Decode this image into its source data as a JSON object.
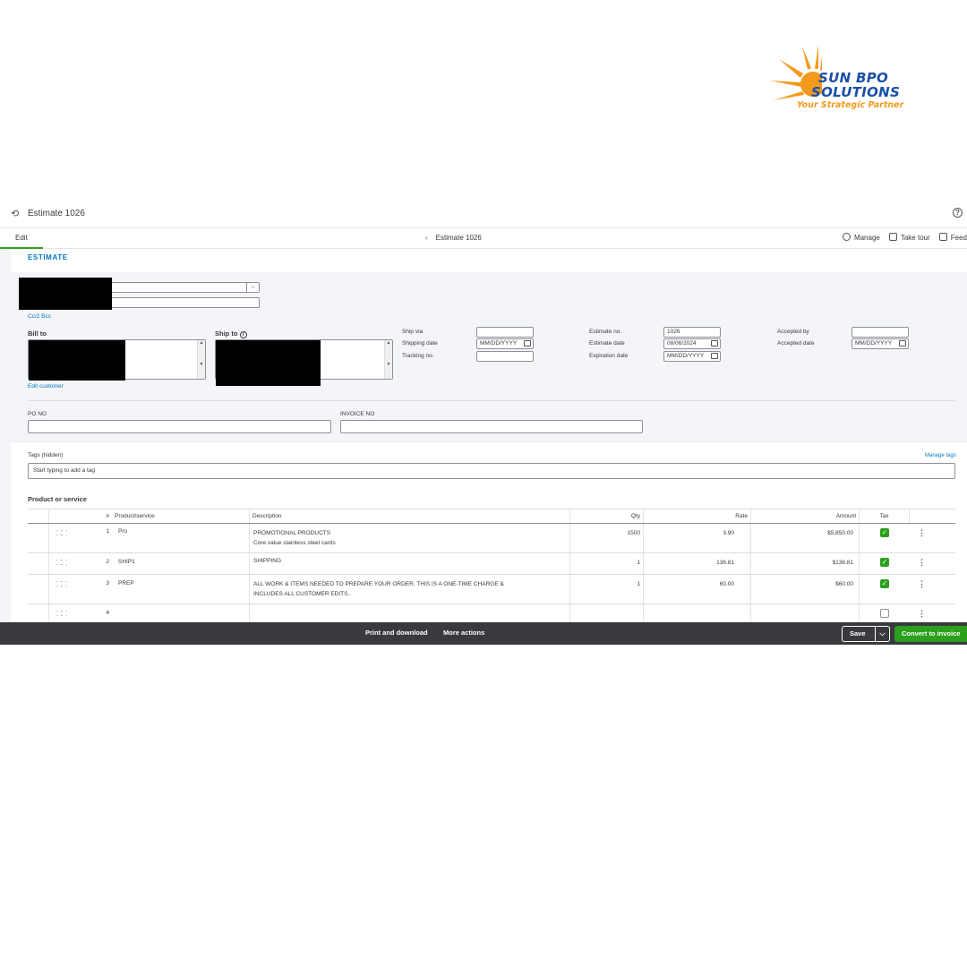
{
  "logo": {
    "line1": "SUN BPO",
    "line2": "SOLUTIONS",
    "tagline": "Your Strategic Partner",
    "colors": {
      "sun": "#f39a1e",
      "text": "#1b4fa8"
    }
  },
  "window": {
    "title": "Estimate 1026"
  },
  "subbar": {
    "tab": "Edit",
    "breadcrumb": "Estimate 1026",
    "manage": "Manage",
    "tour": "Take tour",
    "feedback": "Feed"
  },
  "form": {
    "heading": "ESTIMATE",
    "cc_bcc": "Cc/2 Bcc",
    "bill_to": "Bill to",
    "ship_to": "Ship to",
    "edit_customer": "Edit customer",
    "ship_via": {
      "label": "Ship via",
      "value": ""
    },
    "shipping_date": {
      "label": "Shipping date",
      "placeholder": "MM/DD/YYYY"
    },
    "tracking_no": {
      "label": "Tracking no.",
      "value": ""
    },
    "estimate_no": {
      "label": "Estimate no.",
      "value": "1026"
    },
    "estimate_date": {
      "label": "Estimate date",
      "value": "08/06/2024"
    },
    "expiration_date": {
      "label": "Expiration date",
      "placeholder": "MM/DD/YYYY"
    },
    "accepted_by": {
      "label": "Accepted by",
      "value": ""
    },
    "accepted_date": {
      "label": "Accepted date",
      "placeholder": "MM/DD/YYYY"
    },
    "po_no": {
      "label": "PO NO",
      "value": ""
    },
    "invoice_no": {
      "label": "INVOICE NO",
      "value": ""
    },
    "tags": {
      "label": "Tags (hidden)",
      "manage": "Manage tags",
      "placeholder": "Start typing to add a tag"
    }
  },
  "products": {
    "title": "Product or service",
    "columns": {
      "num": "#",
      "product": "Product/service",
      "description": "Description",
      "qty": "Qty",
      "rate": "Rate",
      "amount": "Amount",
      "tax": "Tax"
    },
    "rows": [
      {
        "num": "1",
        "product": "Pro",
        "description": "PROMOTIONAL PRODUCTS",
        "description2": "Core value stainless steel cards",
        "qty": "1500",
        "rate": "3.90",
        "amount": "$5,850.00",
        "tax": true
      },
      {
        "num": "2",
        "product": "SHIP1",
        "description": "SHIPPING",
        "description2": "",
        "qty": "1",
        "rate": "136.81",
        "amount": "$136.81",
        "tax": true
      },
      {
        "num": "3",
        "product": "PREP",
        "description": "ALL WORK & ITEMS NEEDED TO PREPARE YOUR ORDER. THIS IS A ONE-TIME CHARGE &",
        "description2": "INCLUDES ALL CUSTOMER EDITS..",
        "qty": "1",
        "rate": "60.00",
        "amount": "$60.00",
        "tax": true
      },
      {
        "num": "4",
        "product": "",
        "description": "",
        "description2": "",
        "qty": "",
        "rate": "",
        "amount": "",
        "tax": false
      }
    ]
  },
  "footer": {
    "print": "Print and download",
    "more": "More actions",
    "save": "Save",
    "convert": "Convert to invoice"
  }
}
